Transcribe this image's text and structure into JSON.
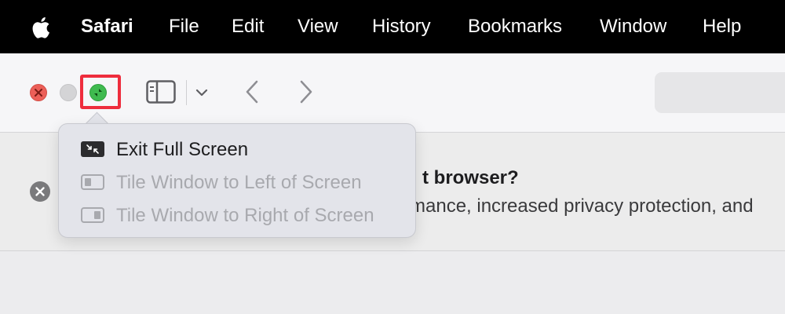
{
  "menubar": {
    "app_name": "Safari",
    "items": [
      "File",
      "Edit",
      "View",
      "History",
      "Bookmarks",
      "Window",
      "Help"
    ]
  },
  "toolbar": {
    "icons": [
      "close-window-icon",
      "minimize-window-icon",
      "zoom-window-icon",
      "sidebar-icon",
      "chevron-down-icon",
      "back-icon",
      "forward-icon"
    ]
  },
  "banner": {
    "title": "t browser?",
    "text": "mance, increased privacy protection, and"
  },
  "popup_menu": {
    "items": [
      {
        "label": "Exit Full Screen",
        "enabled": true,
        "icon": "exit-fullscreen-icon"
      },
      {
        "label": "Tile Window to Left of Screen",
        "enabled": false,
        "icon": "tile-left-icon"
      },
      {
        "label": "Tile Window to Right of Screen",
        "enabled": false,
        "icon": "tile-right-icon"
      }
    ]
  },
  "colors": {
    "menubar_bg": "#000000",
    "close": "#ec5f58",
    "zoom": "#3fba4f",
    "highlight": "#ee2d3d"
  }
}
